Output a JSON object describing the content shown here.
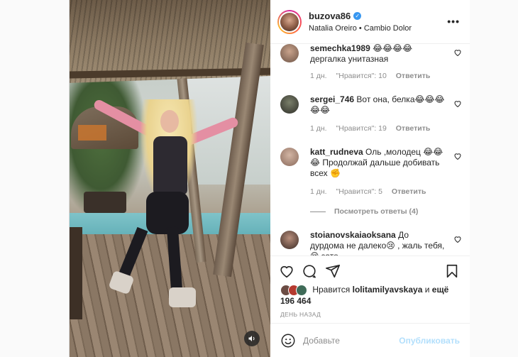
{
  "header": {
    "username": "buzova86",
    "verified_icon": "verified-badge-icon",
    "subtitle": "Natalia Oreiro • Cambio Dolor",
    "more_label": "•••"
  },
  "comments": [
    {
      "username": "semechka1989",
      "text": "😂😂😂😂 дергалка унитазная",
      "time": "1 дн.",
      "likes": "\"Нравится\": 10",
      "reply": "Ответить"
    },
    {
      "username": "sergei_746",
      "text": "Вот она, белка😂😂😂😂😂",
      "time": "1 дн.",
      "likes": "\"Нравится\": 19",
      "reply": "Ответить"
    },
    {
      "username": "katt_rudneva",
      "text": "Оль ,молодец 😂😂😂 Продолжай дальше добивать всех ✊",
      "time": "1 дн.",
      "likes": "\"Нравится\": 5",
      "reply": "Ответить",
      "view_replies": "Посмотреть ответы (4)"
    },
    {
      "username": "stoianovskaiaoksana",
      "text": "До дурдома не далеко😢 , жаль тебя,😢 зато"
    }
  ],
  "likes": {
    "prefix": "Нравится",
    "user": "lolitamilyavskaya",
    "middle": "и",
    "more": "ещё 196 464"
  },
  "date": "ДЕНЬ НАЗАД",
  "add_comment": {
    "placeholder": "Добавьте",
    "publish": "Опубликовать"
  },
  "colors": {
    "accent": "#3897f0",
    "publish_disabled": "#b2dffc",
    "muted": "#8e8e8e"
  }
}
